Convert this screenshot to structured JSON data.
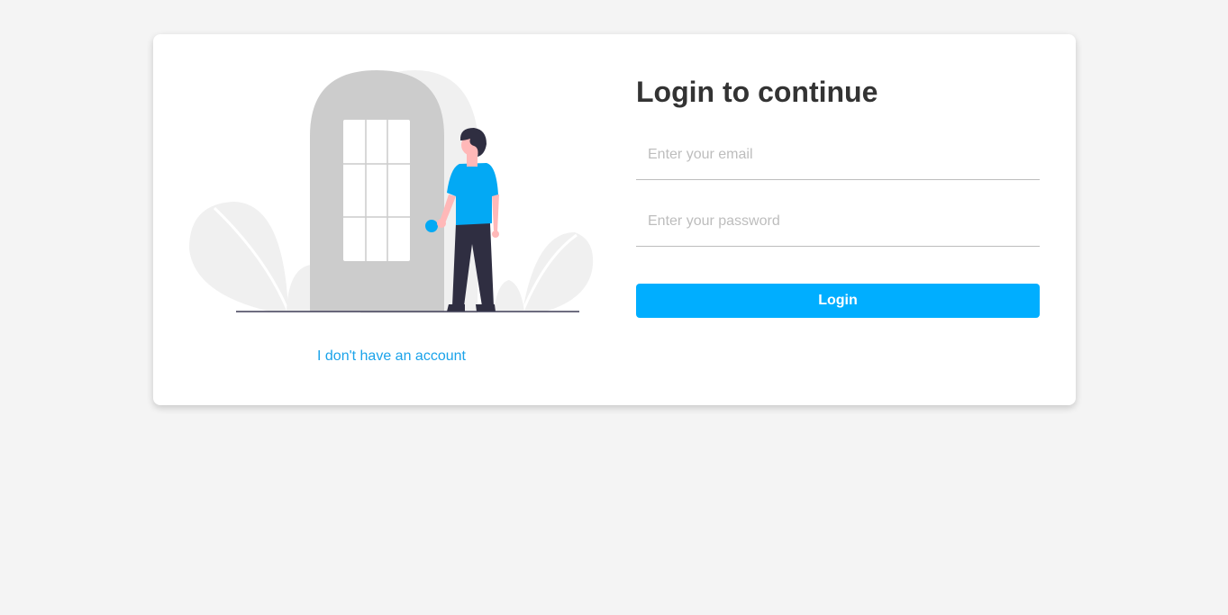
{
  "login": {
    "title": "Login to continue",
    "email_placeholder": "Enter your email",
    "password_placeholder": "Enter your password",
    "button_label": "Login",
    "signup_link": "I don't have an account"
  },
  "colors": {
    "accent": "#00aeff",
    "link": "#1aa3ea",
    "title": "#333333",
    "page_background": "#f4f4f4",
    "door": "#cccccc",
    "person_shirt": "#03a9f4",
    "person_pants": "#2f2e41"
  },
  "icons": {
    "illustration": "person-at-door-illustration"
  }
}
